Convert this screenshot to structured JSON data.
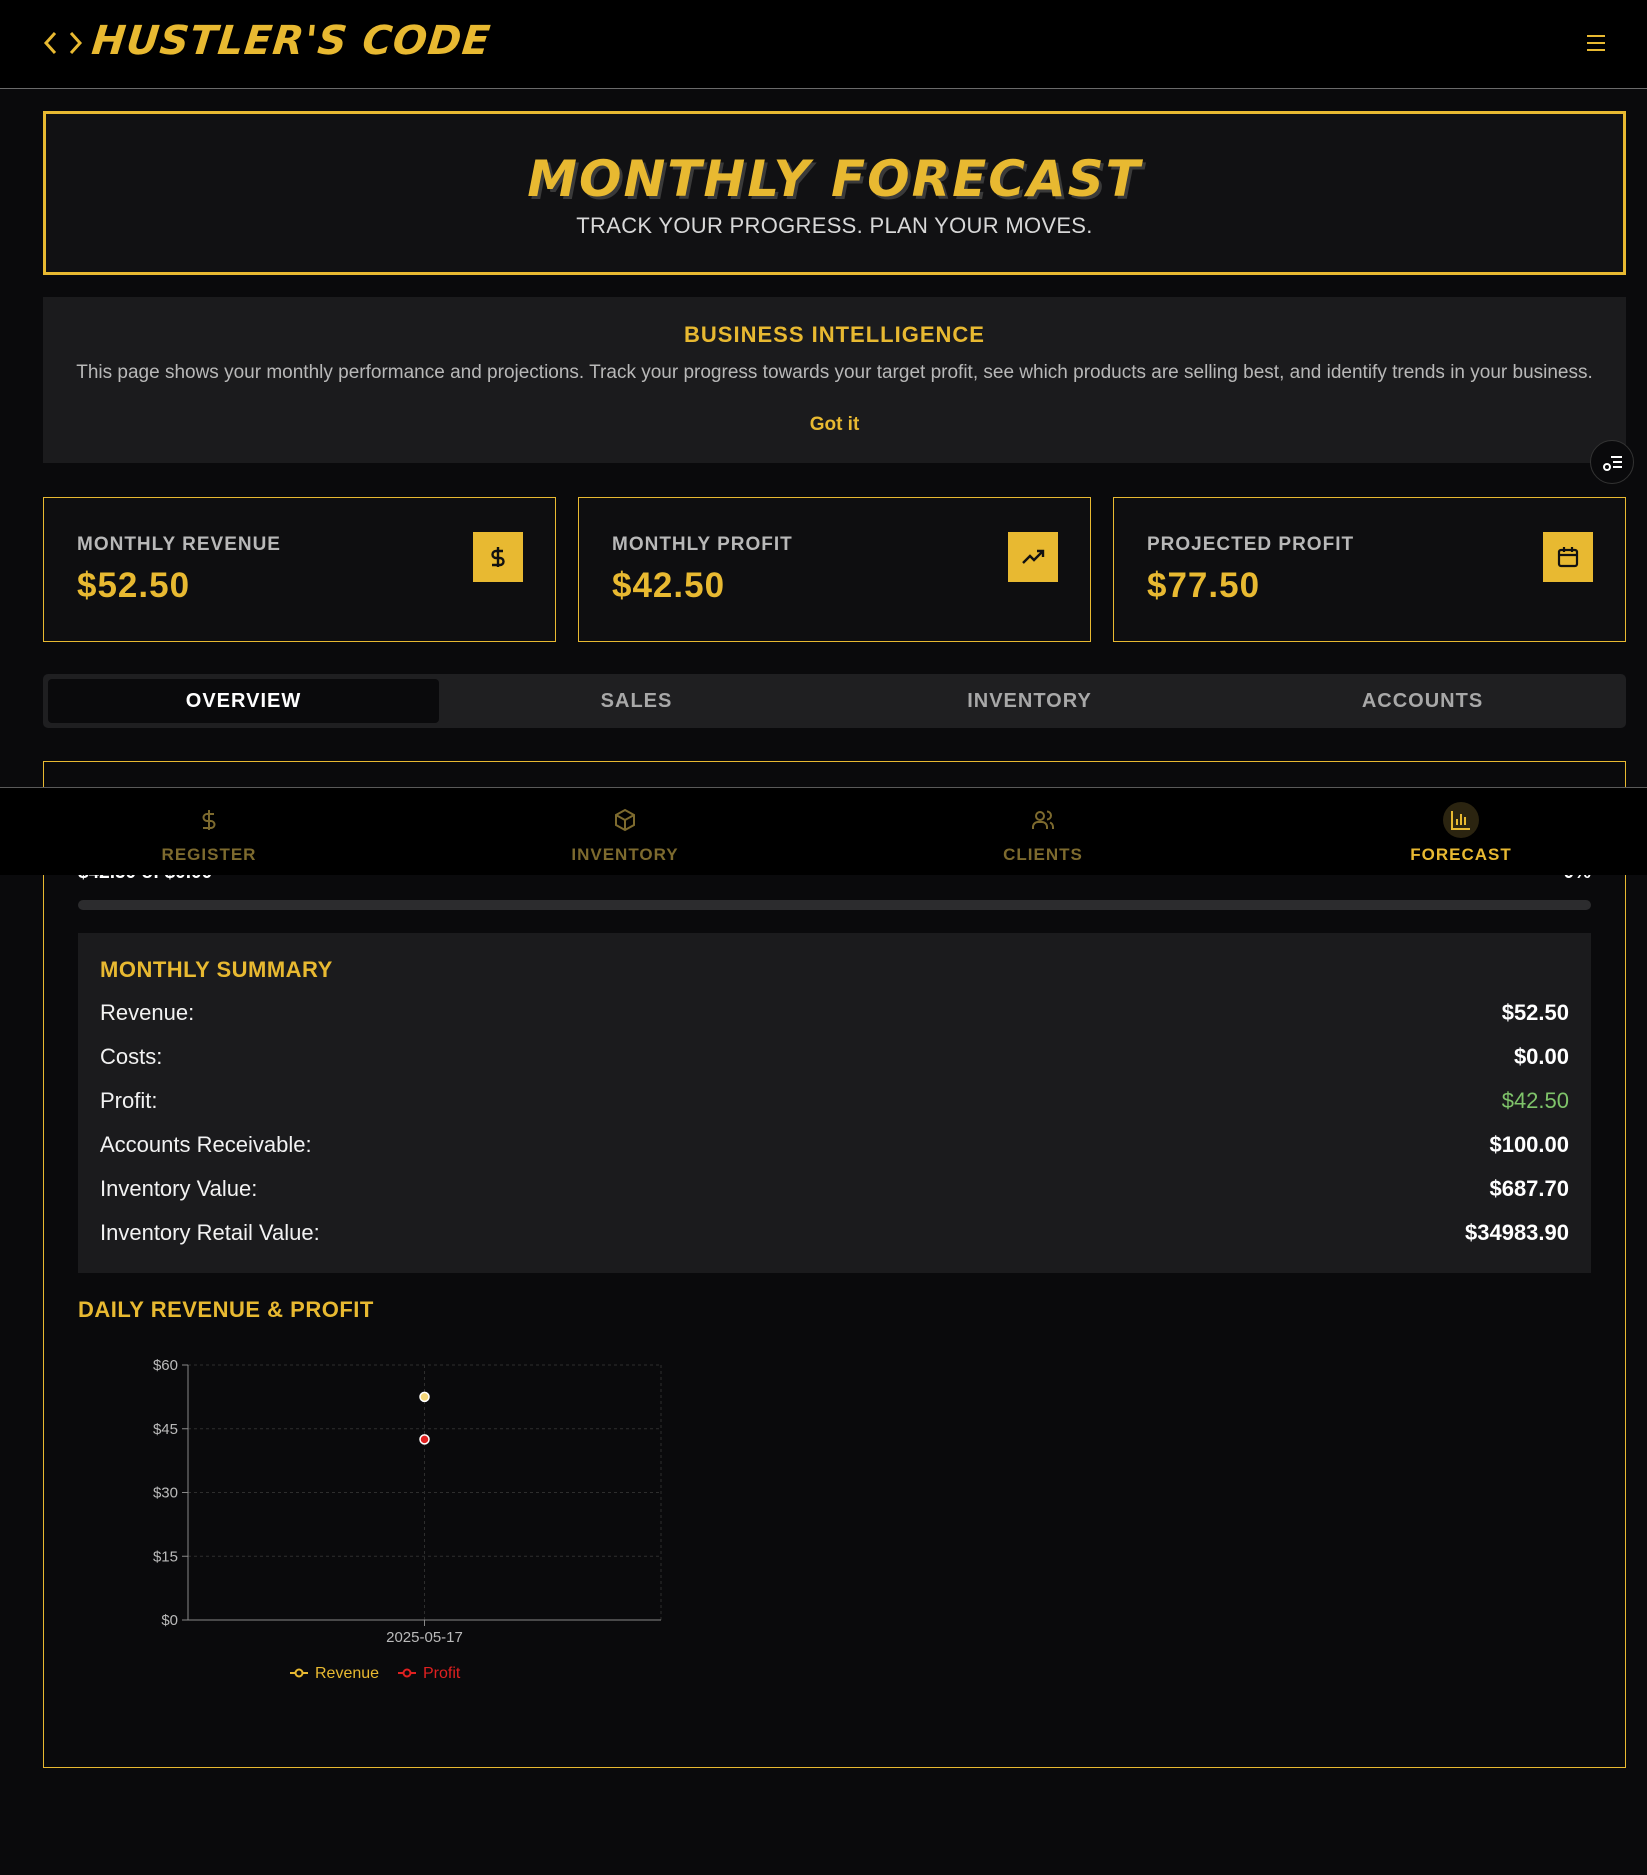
{
  "app": {
    "title": "HUSTLER'S CODE",
    "accent": "#e8b931",
    "logo_icon": "code-brackets-icon",
    "menu_icon": "hamburger-menu-icon"
  },
  "hero": {
    "title": "MONTHLY FORECAST",
    "subtitle": "TRACK YOUR PROGRESS. PLAN YOUR MOVES."
  },
  "info": {
    "title": "BUSINESS INTELLIGENCE",
    "text": "This page shows your monthly performance and projections. Track your progress towards your target profit, see which products are selling best, and identify trends in your business.",
    "dismiss": "Got it"
  },
  "stats": [
    {
      "label": "MONTHLY REVENUE",
      "value": "$52.50",
      "icon": "dollar-icon"
    },
    {
      "label": "MONTHLY PROFIT",
      "value": "$42.50",
      "icon": "trending-up-icon"
    },
    {
      "label": "PROJECTED PROFIT",
      "value": "$77.50",
      "icon": "calendar-icon"
    }
  ],
  "tabs": [
    {
      "label": "OVERVIEW",
      "active": true
    },
    {
      "label": "SALES",
      "active": false
    },
    {
      "label": "INVENTORY",
      "active": false
    },
    {
      "label": "ACCOUNTS",
      "active": false
    }
  ],
  "progress": {
    "label": "$42.50 of $0.00",
    "percent_text": "0%",
    "fraction": 0
  },
  "bottom_nav": [
    {
      "label": "REGISTER",
      "icon": "dollar-icon",
      "active": false
    },
    {
      "label": "INVENTORY",
      "icon": "box-icon",
      "active": false
    },
    {
      "label": "CLIENTS",
      "icon": "users-icon",
      "active": false
    },
    {
      "label": "FORECAST",
      "icon": "bar-chart-icon",
      "active": true
    }
  ],
  "summary": {
    "title": "MONTHLY SUMMARY",
    "rows": [
      {
        "label": "Revenue:",
        "value": "$52.50"
      },
      {
        "label": "Costs:",
        "value": "$0.00"
      },
      {
        "label": "Profit:",
        "value": "$42.50",
        "highlight": "#7fc46a"
      },
      {
        "label": "Accounts Receivable:",
        "value": "$100.00"
      },
      {
        "label": "Inventory Value:",
        "value": "$687.70"
      },
      {
        "label": "Inventory Retail Value:",
        "value": "$34983.90"
      }
    ]
  },
  "chart_title": "DAILY REVENUE & PROFIT",
  "chart_data": {
    "type": "line",
    "x": [
      "2025-05-17"
    ],
    "series": [
      {
        "name": "Revenue",
        "values": [
          52.5
        ],
        "color": "#f5d77a"
      },
      {
        "name": "Profit",
        "values": [
          42.5
        ],
        "color": "#e02020"
      }
    ],
    "yticks": [
      "$0",
      "$15",
      "$30",
      "$45",
      "$60"
    ],
    "ylim": [
      0,
      60
    ],
    "grid": true,
    "legend": "bottom"
  }
}
